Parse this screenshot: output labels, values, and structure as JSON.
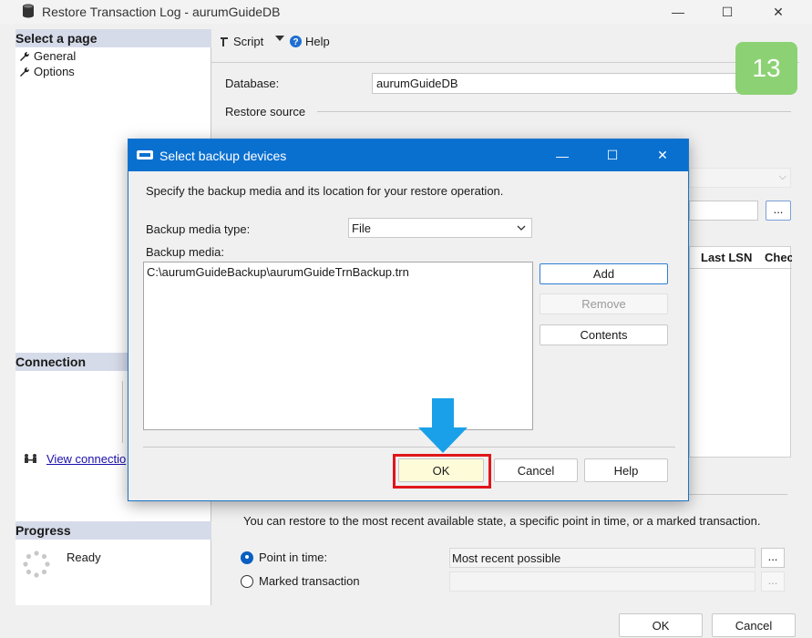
{
  "window": {
    "title": "Restore Transaction Log  -  aurumGuideDB",
    "minimize": "—",
    "maximize": "☐",
    "close": "✕"
  },
  "sidebar": {
    "select_page_header": "Select a page",
    "pages": [
      {
        "label": "General",
        "icon": "wrench-icon"
      },
      {
        "label": "Options",
        "icon": "wrench-icon"
      }
    ],
    "connection_header": "Connection",
    "connection_link": "View connectio",
    "progress_header": "Progress",
    "progress_status": "Ready"
  },
  "toolbar": {
    "script_label": "Script",
    "help_label": "Help"
  },
  "general": {
    "database_label": "Database:",
    "database_value": "aurumGuideDB",
    "restore_source_label": "Restore source",
    "grid_columns": [
      "Last LSN",
      "Chec"
    ]
  },
  "restore_to": {
    "description": "You can restore to the most recent available state, a specific point in time, or a marked transaction.",
    "point_in_time_label": "Point in time:",
    "point_in_time_value": "Most recent possible",
    "marked_transaction_label": "Marked transaction",
    "browse_label": "..."
  },
  "main_buttons": {
    "ok": "OK",
    "cancel": "Cancel"
  },
  "dialog": {
    "title": "Select backup devices",
    "description": "Specify the backup media and its location for your restore operation.",
    "media_type_label": "Backup media type:",
    "media_type_value": "File",
    "media_label": "Backup media:",
    "media_items": [
      "C:\\aurumGuideBackup\\aurumGuideTrnBackup.trn"
    ],
    "add": "Add",
    "remove": "Remove",
    "contents": "Contents",
    "ok": "OK",
    "cancel": "Cancel",
    "help": "Help",
    "minimize": "—",
    "maximize": "☐",
    "close": "✕"
  },
  "annotation": {
    "step_number": "13",
    "highlight_color": "#e0161b",
    "arrow_color": "#1aa0e8",
    "badge_color": "#8cd274"
  }
}
